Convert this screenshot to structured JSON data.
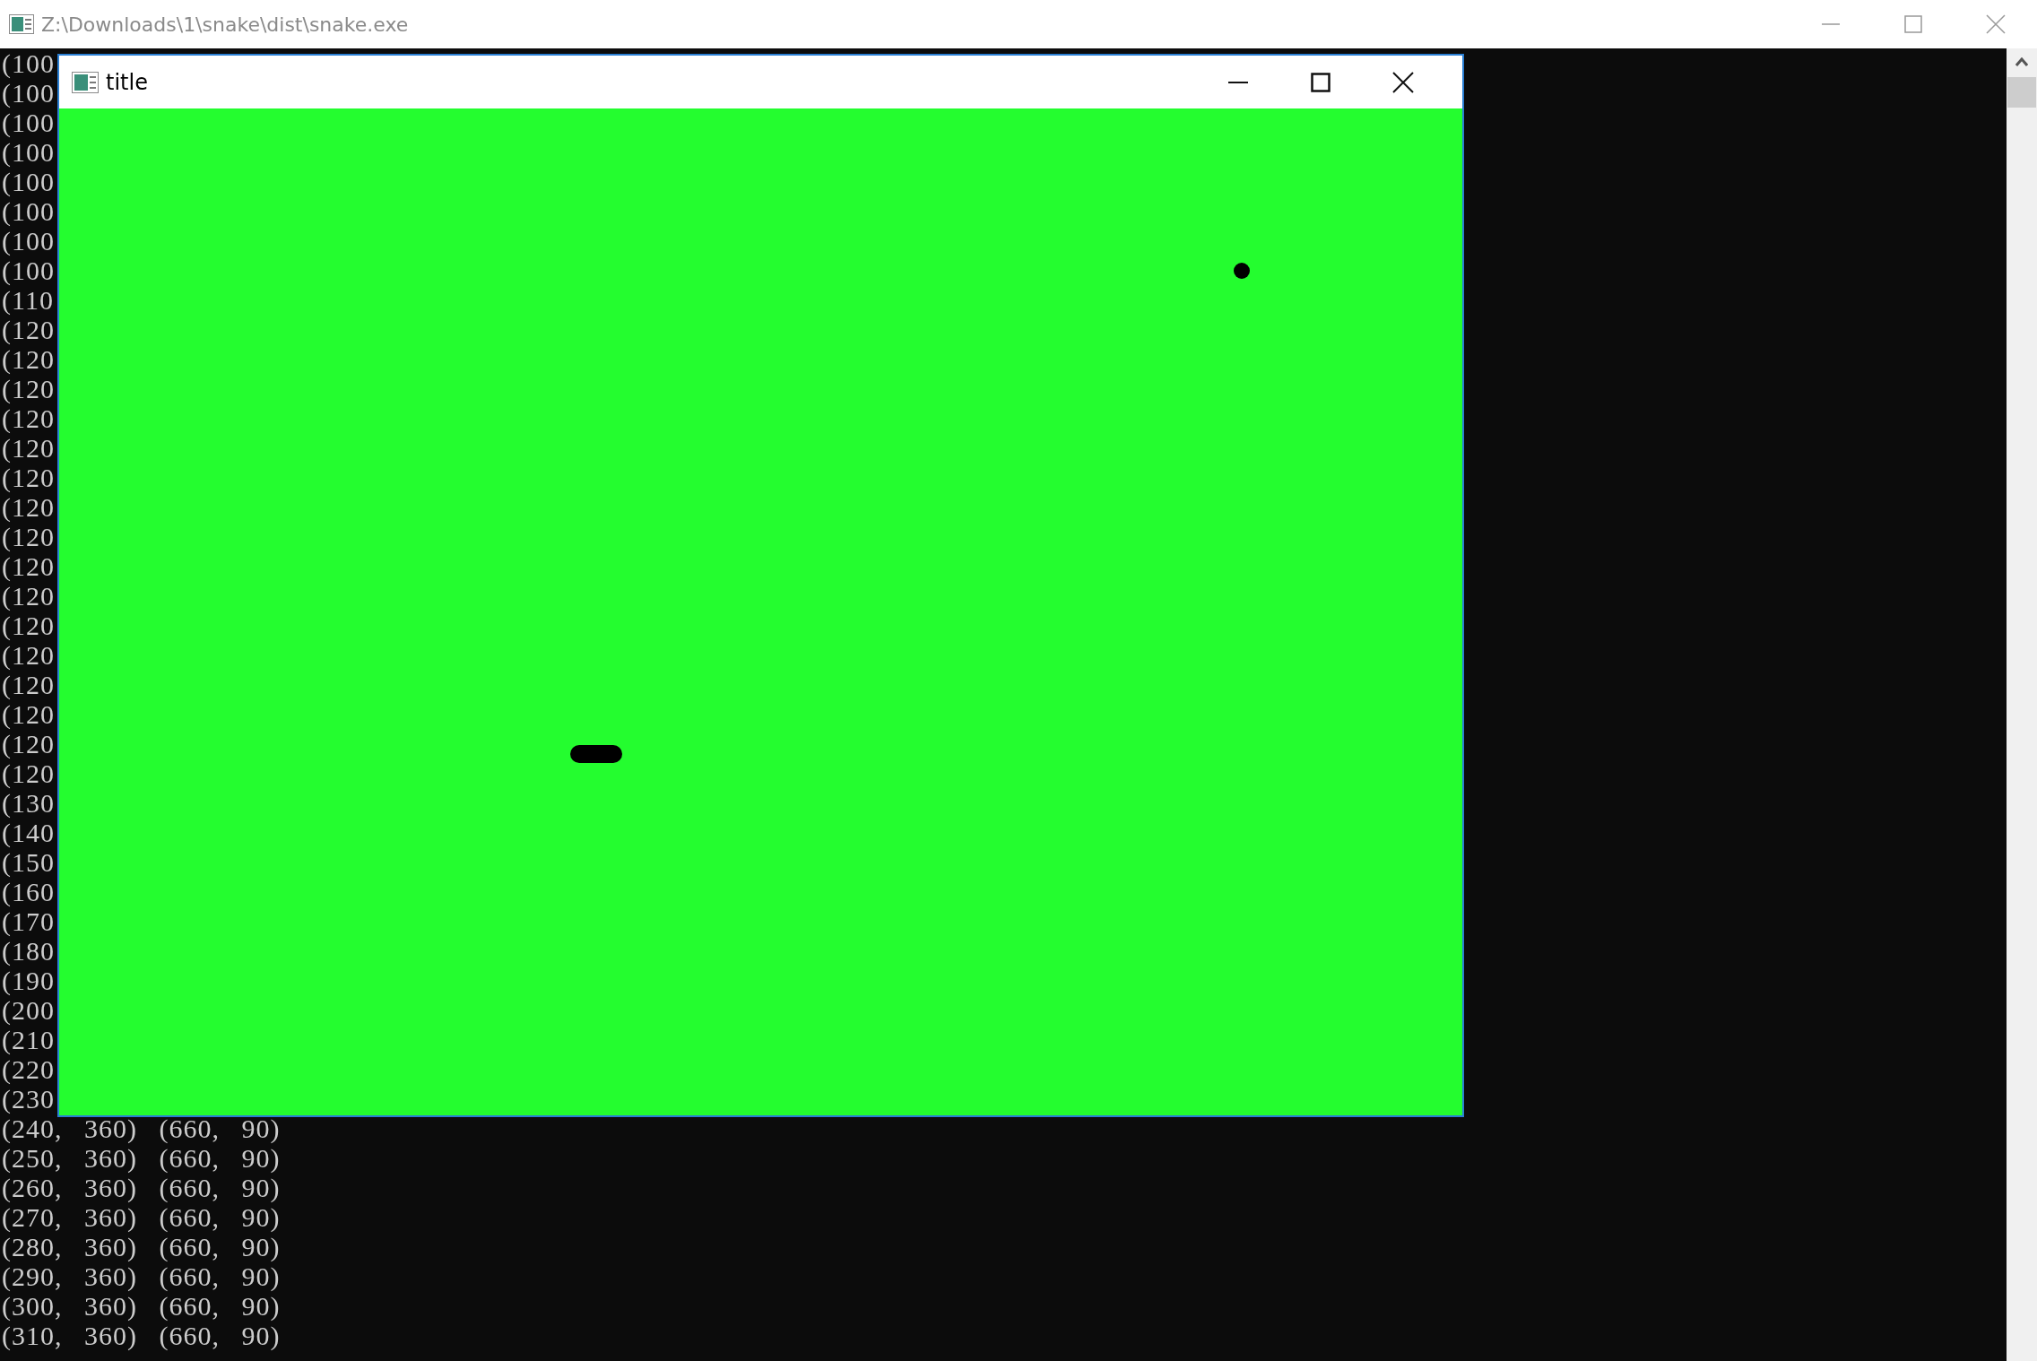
{
  "console_window": {
    "title": "Z:\\Downloads\\1\\snake\\dist\\snake.exe"
  },
  "console_lines": [
    "(100",
    "(100",
    "(100",
    "(100",
    "(100",
    "(100",
    "(100",
    "(100",
    "(110",
    "(120",
    "(120",
    "(120",
    "(120",
    "(120",
    "(120",
    "(120",
    "(120",
    "(120",
    "(120",
    "(120",
    "(120",
    "(120",
    "(120",
    "(120",
    "(120",
    "(130",
    "(140",
    "(150",
    "(160",
    "(170",
    "(180",
    "(190",
    "(200",
    "(210",
    "(220",
    "(230",
    "(240, 360) (660, 90)",
    "(250, 360) (660, 90)",
    "(260, 360) (660, 90)",
    "(270, 360) (660, 90)",
    "(280, 360) (660, 90)",
    "(290, 360) (660, 90)",
    "(300, 360) (660, 90)",
    "(310, 360) (660, 90)"
  ],
  "game_window": {
    "title": "title"
  }
}
